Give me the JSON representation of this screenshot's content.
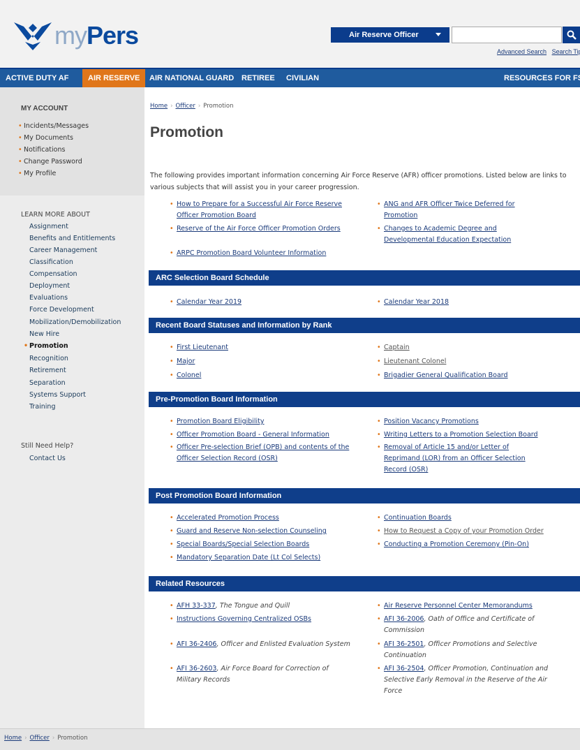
{
  "header": {
    "logo_my": "my",
    "logo_pers": "Pers",
    "search_select": "Air Reserve Officer",
    "search_value": "",
    "advanced_search": "Advanced Search",
    "search_tips": "Search Tips"
  },
  "nav": {
    "active_duty": "ACTIVE DUTY AF",
    "air_reserve": "AIR RESERVE",
    "air_national_guard": "AIR NATIONAL GUARD",
    "retiree": "RETIREE",
    "civilian": "CIVILIAN",
    "resources_fss": "RESOURCES FOR FSS"
  },
  "sidebar": {
    "my_account_title": "MY ACCOUNT",
    "account_items": [
      "Incidents/Messages",
      "My Documents",
      "Notifications",
      "Change Password",
      "My Profile"
    ],
    "learn_title": "LEARN MORE ABOUT",
    "learn_items": [
      "Assignment",
      "Benefits and Entitlements",
      "Career Management",
      "Classification",
      "Compensation",
      "Deployment",
      "Evaluations",
      "Force Development",
      "Mobilization/Demobilization",
      "New Hire",
      "Promotion",
      "Recognition",
      "Retirement",
      "Separation",
      "Systems Support",
      "Training"
    ],
    "help_title": "Still Need Help?",
    "contact_us": "Contact Us"
  },
  "breadcrumb": {
    "home": "Home",
    "officer": "Officer",
    "current": "Promotion"
  },
  "page_title": "Promotion",
  "intro": "The following provides important information concerning Air Force Reserve (AFR) officer promotions. Listed below are links to various subjects that will assist you in your career progression.",
  "top_links": {
    "left": [
      "How to Prepare for a Successful Air Force Reserve Officer Promotion Board",
      "Reserve of the Air Force Officer Promotion Orders",
      "ARPC Promotion Board Volunteer Information"
    ],
    "right": [
      "ANG and AFR Officer Twice Deferred for Promotion",
      "Changes to Academic Degree and Developmental Education Expectation"
    ]
  },
  "sections": {
    "arc": {
      "title": "ARC Selection Board Schedule",
      "left": [
        "Calendar Year 2019"
      ],
      "right": [
        "Calendar Year 2018"
      ]
    },
    "recent": {
      "title": "Recent Board Statuses and Information by Rank",
      "left": [
        "First Lieutenant",
        "Major",
        "Colonel"
      ],
      "right": [
        "Captain",
        "Lieutenant Colonel",
        "Brigadier General Qualification Board"
      ]
    },
    "pre": {
      "title": "Pre-Promotion Board Information",
      "left": [
        "Promotion Board Eligibility",
        "Officer Promotion Board - General Information",
        "Officer Pre-selection Brief (OPB) and contents of the Officer Selection Record (OSR)"
      ],
      "right": [
        "Position Vacancy Promotions",
        "Writing Letters to a Promotion Selection Board",
        "Removal of Article 15 and/or Letter of Reprimand (LOR) from an Officer Selection Record (OSR)"
      ]
    },
    "post": {
      "title": "Post Promotion Board Information",
      "left": [
        "Accelerated Promotion Process",
        "Guard and Reserve Non-selection Counseling",
        "Special Boards/Special Selection Boards",
        "Mandatory Separation Date (Lt Col Selects)"
      ],
      "right": [
        "Continuation Boards",
        "How to Request a Copy of your Promotion Order",
        "Conducting a Promotion Ceremony (Pin-On)"
      ]
    },
    "related": {
      "title": "Related Resources",
      "left": [
        {
          "link": "AFH 33-337",
          "rest": ", The Tongue and Quill"
        },
        {
          "link": "Instructions Governing Centralized OSBs",
          "rest": ""
        },
        {
          "link": "AFI 36-2406",
          "rest": ", Officer and Enlisted Evaluation System"
        },
        {
          "link": "AFI 36-2603",
          "rest": ", Air Force Board for Correction of Military Records"
        }
      ],
      "right": [
        {
          "link": "Air Reserve Personnel Center Memorandums",
          "rest": ""
        },
        {
          "link": "AFI 36-2006",
          "rest": ", Oath of Office and Certificate of Commission"
        },
        {
          "link": "AFI 36-2501",
          "rest": ", Officer Promotions and Selective Continuation"
        },
        {
          "link": "AFI 36-2504",
          "rest": ", Officer Promotion, Continuation and Selective Early Removal in the Reserve of the Air Force"
        }
      ]
    }
  },
  "footer": {
    "home": "Home",
    "officer": "Officer",
    "current": "Promotion"
  },
  "colors": {
    "brand_blue": "#0f3e8a",
    "nav_blue": "#1f5b9e",
    "accent_orange": "#e0761a"
  }
}
